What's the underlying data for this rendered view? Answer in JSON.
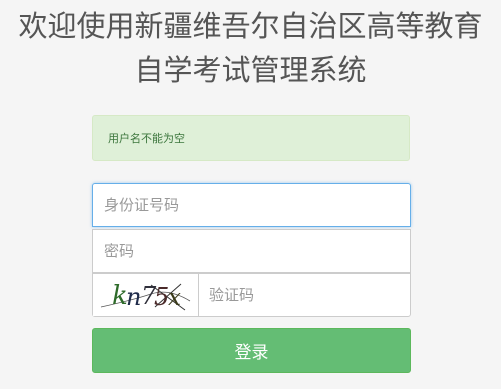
{
  "header": {
    "title_line1": "欢迎使用新疆维吾尔自治区高等教育",
    "title_line2": "自学考试管理系统"
  },
  "alert": {
    "message": "用户名不能为空",
    "status_color": "#3c763d"
  },
  "form": {
    "id_card": {
      "placeholder": "身份证号码",
      "value": ""
    },
    "password": {
      "placeholder": "密码",
      "value": ""
    },
    "captcha": {
      "image_text": "kn75x",
      "placeholder": "验证码",
      "value": ""
    },
    "login_label": "登录"
  },
  "colors": {
    "accent": "#64bd74",
    "focus_border": "#66afe9",
    "alert_bg": "#dff0d8"
  }
}
